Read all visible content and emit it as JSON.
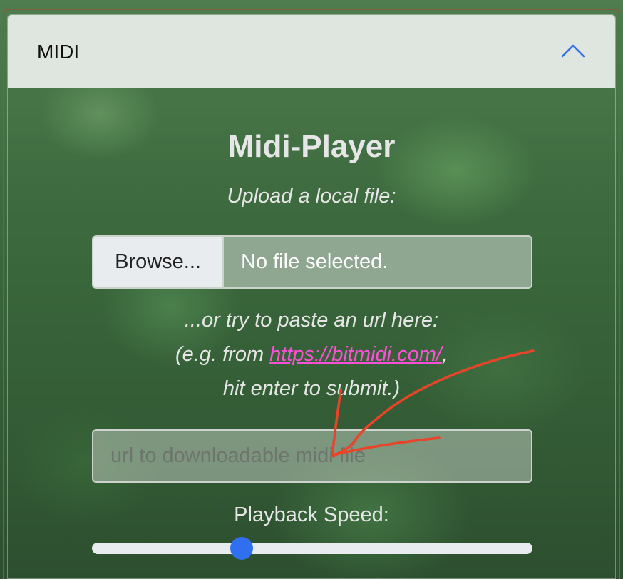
{
  "header": {
    "title": "MIDI",
    "collapse_icon": "chevron-up-icon"
  },
  "player": {
    "title": "Midi-Player",
    "upload_prompt": "Upload a local file:",
    "browse_label": "Browse...",
    "file_status": "No file selected.",
    "url_prompt_line1": "...or try to paste an url here:",
    "url_prompt_prefix": "(e.g. from ",
    "url_example_link": "https://bitmidi.com/",
    "url_prompt_suffix": ",",
    "url_prompt_line3": "hit enter to submit.)",
    "url_placeholder": "url to downloadable midi file",
    "url_value": "",
    "speed_label": "Playback Speed:",
    "speed_fraction": 0.34
  },
  "colors": {
    "accent": "#2f6ff0",
    "link": "#ff4fd8",
    "annotation": "#e8442a"
  }
}
